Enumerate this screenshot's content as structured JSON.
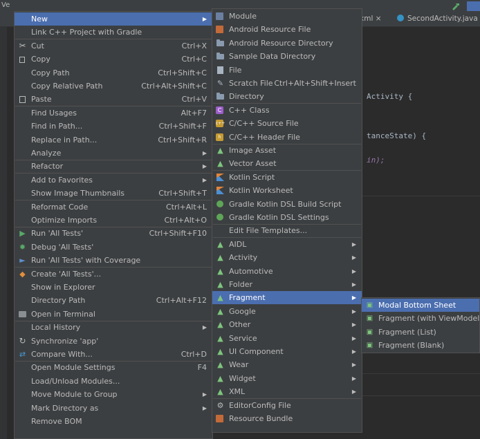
{
  "background": {
    "tabs": [
      {
        "label": "xml ×",
        "icon": ""
      },
      {
        "label": "SecondActivity.java",
        "icon": "java-class-icon"
      }
    ],
    "code_lines": [
      "Activity {",
      "tanceState) {",
      "in);"
    ],
    "window_title_fragment": "Ve"
  },
  "context_menu": {
    "items": [
      {
        "label": "New",
        "shortcut": "",
        "submenu": true,
        "icon": "",
        "highlighted": true
      },
      {
        "label": "Link C++ Project with Gradle",
        "shortcut": "",
        "submenu": false,
        "icon": ""
      },
      {
        "label": "Cut",
        "shortcut": "Ctrl+X",
        "submenu": false,
        "icon": "scissors-icon"
      },
      {
        "label": "Copy",
        "shortcut": "Ctrl+C",
        "submenu": false,
        "icon": "copy-icon"
      },
      {
        "label": "Copy Path",
        "shortcut": "Ctrl+Shift+C",
        "submenu": false,
        "icon": ""
      },
      {
        "label": "Copy Relative Path",
        "shortcut": "Ctrl+Alt+Shift+C",
        "submenu": false,
        "icon": ""
      },
      {
        "label": "Paste",
        "shortcut": "Ctrl+V",
        "submenu": false,
        "icon": "paste-icon"
      },
      {
        "label": "Find Usages",
        "shortcut": "Alt+F7",
        "submenu": false,
        "icon": ""
      },
      {
        "label": "Find in Path...",
        "shortcut": "Ctrl+Shift+F",
        "submenu": false,
        "icon": ""
      },
      {
        "label": "Replace in Path...",
        "shortcut": "Ctrl+Shift+R",
        "submenu": false,
        "icon": ""
      },
      {
        "label": "Analyze",
        "shortcut": "",
        "submenu": true,
        "icon": ""
      },
      {
        "label": "Refactor",
        "shortcut": "",
        "submenu": true,
        "icon": ""
      },
      {
        "label": "Add to Favorites",
        "shortcut": "",
        "submenu": true,
        "icon": ""
      },
      {
        "label": "Show Image Thumbnails",
        "shortcut": "Ctrl+Shift+T",
        "submenu": false,
        "icon": ""
      },
      {
        "label": "Reformat Code",
        "shortcut": "Ctrl+Alt+L",
        "submenu": false,
        "icon": ""
      },
      {
        "label": "Optimize Imports",
        "shortcut": "Ctrl+Alt+O",
        "submenu": false,
        "icon": ""
      },
      {
        "label": "Run 'All Tests'",
        "shortcut": "Ctrl+Shift+F10",
        "submenu": false,
        "icon": "run-icon"
      },
      {
        "label": "Debug 'All Tests'",
        "shortcut": "",
        "submenu": false,
        "icon": "debug-icon"
      },
      {
        "label": "Run 'All Tests' with Coverage",
        "shortcut": "",
        "submenu": false,
        "icon": "coverage-icon"
      },
      {
        "label": "Create 'All Tests'...",
        "shortcut": "",
        "submenu": false,
        "icon": "create-test-icon"
      },
      {
        "label": "Show in Explorer",
        "shortcut": "",
        "submenu": false,
        "icon": ""
      },
      {
        "label": "Directory Path",
        "shortcut": "Ctrl+Alt+F12",
        "submenu": false,
        "icon": ""
      },
      {
        "label": "Open in Terminal",
        "shortcut": "",
        "submenu": false,
        "icon": "terminal-icon"
      },
      {
        "label": "Local History",
        "shortcut": "",
        "submenu": true,
        "icon": ""
      },
      {
        "label": "Synchronize 'app'",
        "shortcut": "",
        "submenu": false,
        "icon": "sync-icon"
      },
      {
        "label": "Compare With...",
        "shortcut": "Ctrl+D",
        "submenu": false,
        "icon": "compare-icon"
      },
      {
        "label": "Open Module Settings",
        "shortcut": "F4",
        "submenu": false,
        "icon": ""
      },
      {
        "label": "Load/Unload Modules...",
        "shortcut": "",
        "submenu": false,
        "icon": ""
      },
      {
        "label": "Move Module to Group",
        "shortcut": "",
        "submenu": true,
        "icon": ""
      },
      {
        "label": "Mark Directory as",
        "shortcut": "",
        "submenu": true,
        "icon": ""
      },
      {
        "label": "Remove BOM",
        "shortcut": "",
        "submenu": false,
        "icon": ""
      }
    ]
  },
  "new_submenu": {
    "items": [
      {
        "label": "Module",
        "shortcut": "",
        "submenu": false,
        "icon": "module-icon"
      },
      {
        "label": "Android Resource File",
        "shortcut": "",
        "submenu": false,
        "icon": "android-resource-file-icon"
      },
      {
        "label": "Android Resource Directory",
        "shortcut": "",
        "submenu": false,
        "icon": "folder-icon"
      },
      {
        "label": "Sample Data Directory",
        "shortcut": "",
        "submenu": false,
        "icon": "folder-icon"
      },
      {
        "label": "File",
        "shortcut": "",
        "submenu": false,
        "icon": "file-icon"
      },
      {
        "label": "Scratch File",
        "shortcut": "Ctrl+Alt+Shift+Insert",
        "submenu": false,
        "icon": "scratch-file-icon"
      },
      {
        "label": "Directory",
        "shortcut": "",
        "submenu": false,
        "icon": "folder-icon"
      },
      {
        "label": "C++ Class",
        "shortcut": "",
        "submenu": false,
        "icon": "cpp-class-icon"
      },
      {
        "label": "C/C++ Source File",
        "shortcut": "",
        "submenu": false,
        "icon": "cpp-source-icon"
      },
      {
        "label": "C/C++ Header File",
        "shortcut": "",
        "submenu": false,
        "icon": "cpp-header-icon"
      },
      {
        "label": "Image Asset",
        "shortcut": "",
        "submenu": false,
        "icon": "android-icon"
      },
      {
        "label": "Vector Asset",
        "shortcut": "",
        "submenu": false,
        "icon": "android-icon"
      },
      {
        "label": "Kotlin Script",
        "shortcut": "",
        "submenu": false,
        "icon": "kotlin-icon"
      },
      {
        "label": "Kotlin Worksheet",
        "shortcut": "",
        "submenu": false,
        "icon": "kotlin-icon"
      },
      {
        "label": "Gradle Kotlin DSL Build Script",
        "shortcut": "",
        "submenu": false,
        "icon": "gradle-icon"
      },
      {
        "label": "Gradle Kotlin DSL Settings",
        "shortcut": "",
        "submenu": false,
        "icon": "gradle-icon"
      },
      {
        "label": "Edit File Templates...",
        "shortcut": "",
        "submenu": false,
        "icon": ""
      },
      {
        "label": "AIDL",
        "shortcut": "",
        "submenu": true,
        "icon": "android-icon"
      },
      {
        "label": "Activity",
        "shortcut": "",
        "submenu": true,
        "icon": "android-icon"
      },
      {
        "label": "Automotive",
        "shortcut": "",
        "submenu": true,
        "icon": "android-icon"
      },
      {
        "label": "Folder",
        "shortcut": "",
        "submenu": true,
        "icon": "android-icon"
      },
      {
        "label": "Fragment",
        "shortcut": "",
        "submenu": true,
        "icon": "android-icon",
        "highlighted": true
      },
      {
        "label": "Google",
        "shortcut": "",
        "submenu": true,
        "icon": "android-icon"
      },
      {
        "label": "Other",
        "shortcut": "",
        "submenu": true,
        "icon": "android-icon"
      },
      {
        "label": "Service",
        "shortcut": "",
        "submenu": true,
        "icon": "android-icon"
      },
      {
        "label": "UI Component",
        "shortcut": "",
        "submenu": true,
        "icon": "android-icon"
      },
      {
        "label": "Wear",
        "shortcut": "",
        "submenu": true,
        "icon": "android-icon"
      },
      {
        "label": "Widget",
        "shortcut": "",
        "submenu": true,
        "icon": "android-icon"
      },
      {
        "label": "XML",
        "shortcut": "",
        "submenu": true,
        "icon": "android-icon"
      },
      {
        "label": "EditorConfig File",
        "shortcut": "",
        "submenu": false,
        "icon": "gear-icon"
      },
      {
        "label": "Resource Bundle",
        "shortcut": "",
        "submenu": false,
        "icon": "resource-bundle-icon"
      }
    ]
  },
  "fragment_submenu": {
    "items": [
      {
        "label": "Modal Bottom Sheet",
        "icon": "fragment-icon",
        "highlighted": true
      },
      {
        "label": "Fragment (with ViewModel)",
        "icon": "fragment-icon"
      },
      {
        "label": "Fragment (List)",
        "icon": "fragment-icon"
      },
      {
        "label": "Fragment (Blank)",
        "icon": "fragment-icon"
      }
    ]
  },
  "colors": {
    "menu_bg": "#3c3f41",
    "highlight": "#4b6eaf",
    "editor_bg": "#2b2b2b",
    "text": "#bbbbbb"
  }
}
